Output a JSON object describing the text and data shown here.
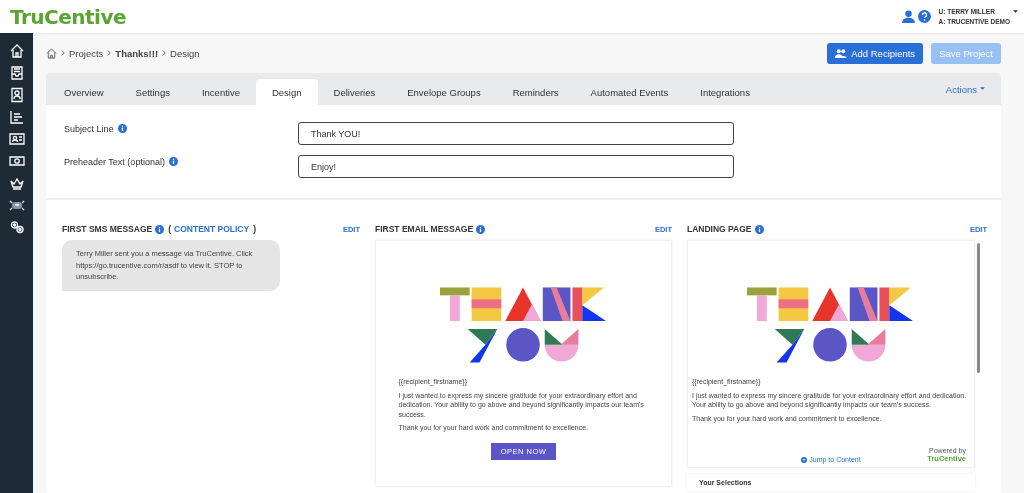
{
  "header": {
    "logo": "TruCentive",
    "user": "U: TERRY MILLER",
    "account": "A: TRUCENTIVE DEMO"
  },
  "breadcrumb": [
    {
      "label": "Projects",
      "bold": false
    },
    {
      "label": "Thanks!!!",
      "bold": true
    },
    {
      "label": "Design",
      "bold": false
    }
  ],
  "buttons": [
    {
      "label": "Add Recipients",
      "disabled": false
    },
    {
      "label": "Save Project",
      "disabled": true
    }
  ],
  "tabs": [
    {
      "label": "Overview",
      "selected": false
    },
    {
      "label": "Settings",
      "selected": false
    },
    {
      "label": "Incentive",
      "selected": false
    },
    {
      "label": "Design",
      "selected": true
    },
    {
      "label": "Deliveries",
      "selected": false
    },
    {
      "label": "Envelope Groups",
      "selected": false
    },
    {
      "label": "Reminders",
      "selected": false
    },
    {
      "label": "Automated Events",
      "selected": false
    },
    {
      "label": "Integrations",
      "selected": false
    }
  ],
  "actions": "Actions",
  "fields": [
    {
      "label": "Subject Line",
      "value": "Thank YOU!"
    },
    {
      "label": "Preheader Text (optional)",
      "value": "Enjoy!"
    }
  ],
  "sms": {
    "title": "FIRST SMS MESSAGE",
    "policy_open": "(",
    "policy_link": "CONTENT POLICY",
    "policy_close": ")",
    "edit": "EDIT",
    "message": "Terry Miller sent you a message via TruCentive. Click https://go.trucentive.com/r/asdf to view it. STOP to unsubscribe."
  },
  "email": {
    "title": "FIRST EMAIL MESSAGE",
    "edit": "EDIT",
    "greeting": "{{recipient_firstname}}",
    "paragraphs": [
      "I just wanted to express my sincere gratitude for your extraordinary effort and dedication. Your ability to go above and beyond significantly impacts our team's success.",
      "Thank you for your hard work and commitment to excellence."
    ],
    "button": "OPEN NOW"
  },
  "landing": {
    "title": "LANDING PAGE",
    "edit": "EDIT",
    "greeting": "{{recipient_firstname}}",
    "paragraphs": [
      "I just wanted to express my sincere gratitude for your extraordinary effort and dedication. Your ability to go above and beyond significantly impacts our team's success.",
      "Thank you for your hard work and commitment to excellence."
    ],
    "jump": "Jump to Content",
    "powered_by": "Powered by",
    "powered_logo": "TruCentive",
    "selections": "Your Selections"
  }
}
